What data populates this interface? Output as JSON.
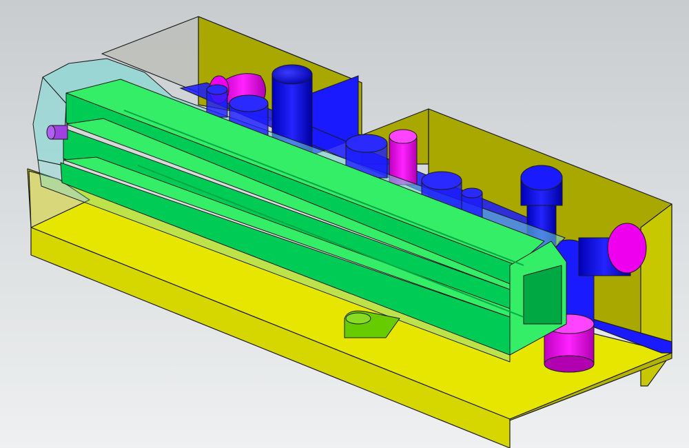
{
  "scene": {
    "view": "isometric",
    "render_style": "shaded-with-edges",
    "background_colors": [
      "#c9cccf",
      "#eef0f1"
    ]
  },
  "palette": {
    "housing_yellow": "#e6e600",
    "housing_olive": "#a8a800",
    "housing_pale": "#d8d87a",
    "glass_cyan": "#6fd9d4",
    "core_green": "#00cc55",
    "core_light_green": "#33ee66",
    "core_dark_green": "#00a844",
    "channel_blue": "#1a1aff",
    "channel_navy": "#0000cc",
    "fitting_magenta": "#ee00ee",
    "fitting_purple": "#b000b0",
    "pin_violet": "#a040e0",
    "bracket_lime": "#66cc00",
    "edge": "#1a1a1a"
  },
  "components": [
    {
      "id": "mold-base",
      "icon": "housing-block-icon"
    },
    {
      "id": "transparent-cavity-plate",
      "icon": "glass-plate-icon"
    },
    {
      "id": "green-core-insert",
      "icon": "core-insert-icon"
    },
    {
      "id": "cooling-channels",
      "icon": "pipe-icon"
    },
    {
      "id": "water-fittings",
      "icon": "connector-icon"
    },
    {
      "id": "ejector-bracket",
      "icon": "bracket-icon"
    }
  ]
}
